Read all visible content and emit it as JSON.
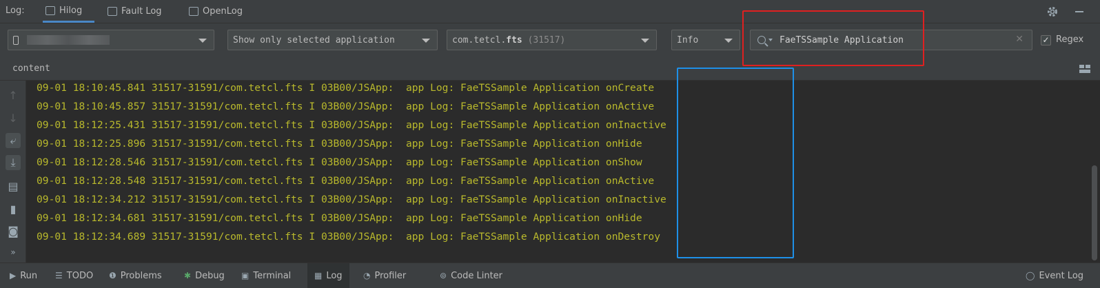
{
  "topbar": {
    "label": "Log:",
    "tabs": [
      {
        "label": "Hilog",
        "active": true
      },
      {
        "label": "Fault Log",
        "active": false
      },
      {
        "label": "OpenLog",
        "active": false
      }
    ],
    "settings_icon": "gear-icon",
    "minimize_icon": "minimize-icon"
  },
  "toolbar": {
    "device_combo": {
      "value": ""
    },
    "filter_combo": {
      "value": "Show only selected application"
    },
    "process_combo": {
      "package": "com.tetcl.",
      "package_bold": "fts",
      "pid": "(31517)"
    },
    "level_combo": {
      "value": "Info"
    },
    "search": {
      "value": "FaeTSSample Application",
      "clear": "✕"
    },
    "regex": {
      "label": "Regex",
      "checked": true
    }
  },
  "header": {
    "content_label": "content"
  },
  "log_lines": [
    {
      "prefix": "09-01 18:10:45.841 31517-31591/com.tetcl.fts I 03B00/JSApp:  app Log: FaeTSSample Application ",
      "event": "onCreate"
    },
    {
      "prefix": "09-01 18:10:45.857 31517-31591/com.tetcl.fts I 03B00/JSApp:  app Log: FaeTSSample Application ",
      "event": "onActive"
    },
    {
      "prefix": "09-01 18:12:25.431 31517-31591/com.tetcl.fts I 03B00/JSApp:  app Log: FaeTSSample Application ",
      "event": "onInactive"
    },
    {
      "prefix": "09-01 18:12:25.896 31517-31591/com.tetcl.fts I 03B00/JSApp:  app Log: FaeTSSample Application ",
      "event": "onHide"
    },
    {
      "prefix": "09-01 18:12:28.546 31517-31591/com.tetcl.fts I 03B00/JSApp:  app Log: FaeTSSample Application ",
      "event": "onShow"
    },
    {
      "prefix": "09-01 18:12:28.548 31517-31591/com.tetcl.fts I 03B00/JSApp:  app Log: FaeTSSample Application ",
      "event": "onActive"
    },
    {
      "prefix": "09-01 18:12:34.212 31517-31591/com.tetcl.fts I 03B00/JSApp:  app Log: FaeTSSample Application ",
      "event": "onInactive"
    },
    {
      "prefix": "09-01 18:12:34.681 31517-31591/com.tetcl.fts I 03B00/JSApp:  app Log: FaeTSSample Application ",
      "event": "onHide"
    },
    {
      "prefix": "09-01 18:12:34.689 31517-31591/com.tetcl.fts I 03B00/JSApp:  app Log: FaeTSSample Application ",
      "event": "onDestroy"
    }
  ],
  "sidebar_icons": [
    "scroll-up-icon",
    "scroll-down-icon",
    "soft-wrap-icon",
    "scroll-to-end-icon",
    "print-icon",
    "clear-log-icon",
    "screenshot-icon",
    "more-icon"
  ],
  "bottom_tabs": [
    {
      "label": "Run",
      "icon": "run-icon"
    },
    {
      "label": "TODO",
      "icon": "todo-icon"
    },
    {
      "label": "Problems",
      "icon": "problems-icon"
    },
    {
      "label": "Debug",
      "icon": "debug-icon"
    },
    {
      "label": "Terminal",
      "icon": "terminal-icon"
    },
    {
      "label": "Log",
      "icon": "log-icon",
      "active": true
    },
    {
      "label": "Profiler",
      "icon": "profiler-icon"
    },
    {
      "label": "Code Linter",
      "icon": "code-linter-icon"
    },
    {
      "label": "Event Log",
      "icon": "event-log-icon"
    }
  ],
  "colors": {
    "log_text": "#b9b92c",
    "highlight_red": "#e02020",
    "highlight_blue": "#1e90e8",
    "active_tab_underline": "#4a88c7"
  }
}
